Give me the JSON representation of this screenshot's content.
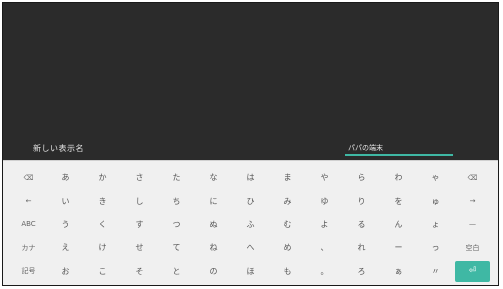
{
  "header": {
    "prompt_label": "新しい表示名",
    "input_value": "パパの端末"
  },
  "keyboard": {
    "rows": [
      [
        "⌫",
        "あ",
        "か",
        "さ",
        "た",
        "な",
        "は",
        "ま",
        "や",
        "ら",
        "わ",
        "ゃ",
        "⌫"
      ],
      [
        "←",
        "い",
        "き",
        "し",
        "ち",
        "に",
        "ひ",
        "み",
        "ゆ",
        "り",
        "を",
        "ゅ",
        "→"
      ],
      [
        "ABC",
        "う",
        "く",
        "す",
        "つ",
        "ぬ",
        "ふ",
        "む",
        "よ",
        "る",
        "ん",
        "ょ",
        "—"
      ],
      [
        "カナ",
        "え",
        "け",
        "せ",
        "て",
        "ね",
        "へ",
        "め",
        "、",
        "れ",
        "ー",
        "っ",
        "空白"
      ],
      [
        "記号",
        "お",
        "こ",
        "そ",
        "と",
        "の",
        "ほ",
        "も",
        "。",
        "ろ",
        "ぁ",
        "〃",
        "⏎"
      ]
    ],
    "enter_icon": "enter-icon"
  }
}
